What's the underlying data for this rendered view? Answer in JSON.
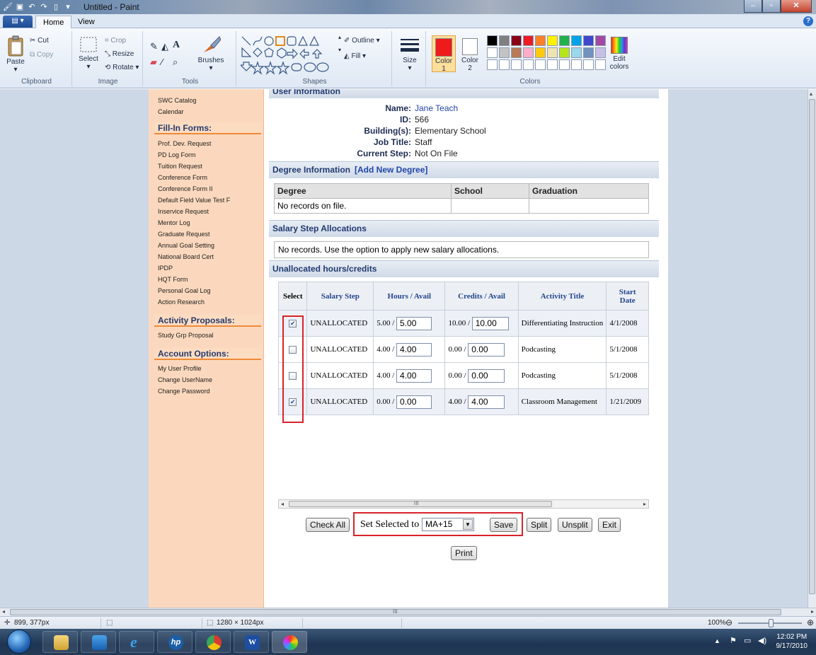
{
  "window": {
    "title": "Untitled - Paint"
  },
  "ribbon": {
    "tabs": [
      "Home",
      "View"
    ],
    "clipboard": {
      "paste": "Paste",
      "cut": "Cut",
      "copy": "Copy",
      "group": "Clipboard"
    },
    "image": {
      "select": "Select",
      "crop": "Crop",
      "resize": "Resize",
      "rotate": "Rotate",
      "group": "Image"
    },
    "tools": {
      "brushes": "Brushes",
      "group": "Tools"
    },
    "shapes": {
      "outline": "Outline",
      "fill": "Fill",
      "group": "Shapes"
    },
    "size": {
      "label": "Size"
    },
    "colors": {
      "color1": "Color",
      "color1_num": "1",
      "color2": "Color",
      "color2_num": "2",
      "edit": "Edit",
      "edit2": "colors",
      "group": "Colors",
      "color1_value": "#ef1b1b",
      "palette_row1": [
        "#000000",
        "#7f7f7f",
        "#880015",
        "#ed1c24",
        "#ff7f27",
        "#fff200",
        "#22b14c",
        "#00a2e8",
        "#3f48cc",
        "#a349a4"
      ],
      "palette_row2": [
        "#ffffff",
        "#c3c3c3",
        "#b97a57",
        "#ffaec9",
        "#ffc90e",
        "#efe4b0",
        "#b5e61d",
        "#99d9ea",
        "#7092be",
        "#c8bfe7"
      ]
    }
  },
  "sidebar": {
    "top_items": [
      "SWC Catalog",
      "Calendar"
    ],
    "fill_in_heading": "Fill-In Forms:",
    "fill_in_items": [
      "Prof. Dev. Request",
      "PD Log Form",
      "Tuition Request",
      "Conference Form",
      "Conference Form II",
      "Default Field Value Test F",
      "Inservice Request",
      "Mentor Log",
      "Graduate Request",
      "Annual Goal Setting",
      "National Board Cert",
      "IPDP",
      "HQT Form",
      "Personal Goal Log",
      "Action Research"
    ],
    "activity_heading": "Activity Proposals:",
    "activity_items": [
      "Study Grp Proposal"
    ],
    "account_heading": "Account Options:",
    "account_items": [
      "My User Profile",
      "Change UserName",
      "Change Password"
    ]
  },
  "user_info": {
    "heading": "User Information",
    "name_label": "Name:",
    "name": "Jane Teach",
    "id_label": "ID:",
    "id": "566",
    "building_label": "Building(s):",
    "building": "Elementary School",
    "job_label": "Job Title:",
    "job": "Staff",
    "step_label": "Current Step:",
    "step": "Not On File"
  },
  "degree": {
    "heading": "Degree Information",
    "add_link": "[Add New Degree]",
    "columns": [
      "Degree",
      "School",
      "Graduation"
    ],
    "empty": "No records on file."
  },
  "salary": {
    "heading": "Salary Step Allocations",
    "empty": "No records. Use the option to apply new salary allocations."
  },
  "unallocated": {
    "heading": "Unallocated hours/credits",
    "columns": [
      "Select",
      "Salary Step",
      "Hours / Avail",
      "Credits / Avail",
      "Activity Title",
      "Start Date"
    ],
    "rows": [
      {
        "checked": true,
        "step": "UNALLOCATED",
        "hours": "5.00 /",
        "hours_input": "5.00",
        "credits": "10.00 /",
        "credits_input": "10.00",
        "title": "Differentiating Instruction",
        "date": "4/1/2008"
      },
      {
        "checked": false,
        "step": "UNALLOCATED",
        "hours": "4.00 /",
        "hours_input": "4.00",
        "credits": "0.00 /",
        "credits_input": "0.00",
        "title": "Podcasting",
        "date": "5/1/2008"
      },
      {
        "checked": false,
        "step": "UNALLOCATED",
        "hours": "4.00 /",
        "hours_input": "4.00",
        "credits": "0.00 /",
        "credits_input": "0.00",
        "title": "Podcasting",
        "date": "5/1/2008"
      },
      {
        "checked": true,
        "step": "UNALLOCATED",
        "hours": "0.00 /",
        "hours_input": "0.00",
        "credits": "4.00 /",
        "credits_input": "4.00",
        "title": "Classroom Management",
        "date": "1/21/2009"
      }
    ]
  },
  "actions": {
    "check_all": "Check All",
    "set_selected": "Set Selected to",
    "selected_value": "MA+15",
    "save": "Save",
    "split": "Split",
    "unsplit": "Unsplit",
    "exit": "Exit",
    "print": "Print",
    "scroll_marker": "III"
  },
  "statusbar": {
    "cursor": "899, 377px",
    "size": "1280 × 1024px",
    "zoom": "100%",
    "canvas_scroll_marker": "III"
  },
  "taskbar": {
    "time": "12:02 PM",
    "date": "9/17/2010"
  }
}
